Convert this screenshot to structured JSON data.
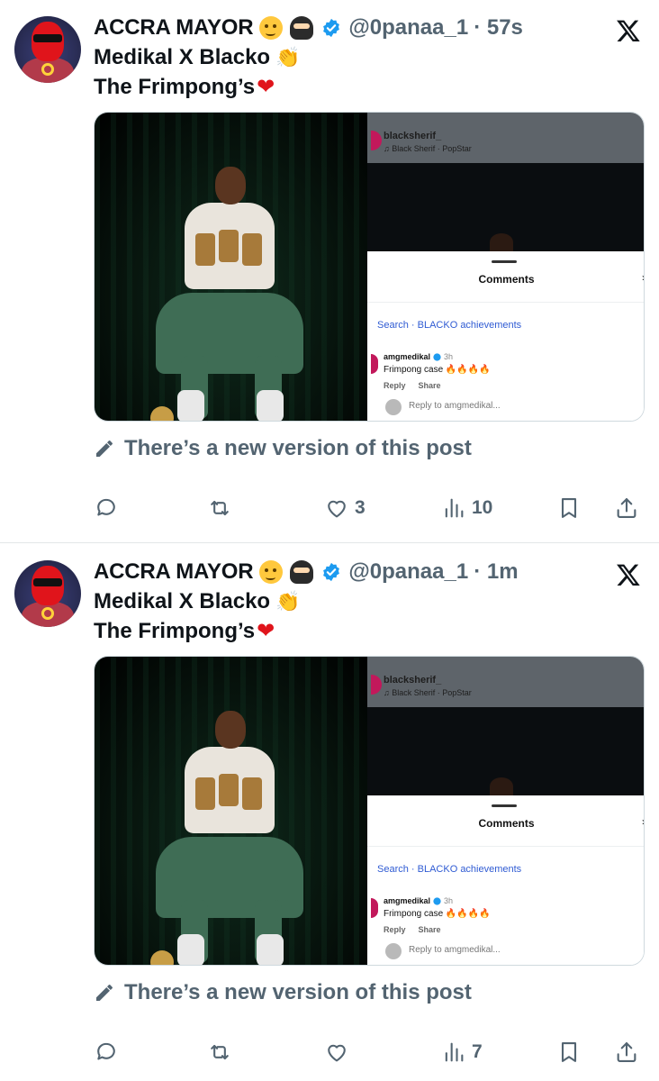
{
  "tweets": [
    {
      "author": {
        "name": "ACCRA MAYOR",
        "handle": "@0panaa_1",
        "time": "· 57s",
        "emojis": [
          "smiling-face-with-tear",
          "ninja"
        ]
      },
      "text": {
        "line1": "Medikal X Blacko",
        "line2": "The Frimpong’s"
      },
      "embed": {
        "ig_user": "blacksherif_",
        "ig_sub": "♫ Black Sherif · PopStar",
        "sheet_title": "Comments",
        "search": "Search · BLACKO achievements",
        "comment_user": "amgmedikal",
        "comment_time": "3h",
        "comment_text": "Frimpong case 🔥🔥🔥🔥",
        "reply_label": "Reply",
        "share_label": "Share",
        "reply_placeholder": "Reply to amgmedikal..."
      },
      "new_version": "There’s a new version of this post",
      "counts": {
        "replies": "",
        "reposts": "",
        "likes": "3",
        "views": "10"
      }
    },
    {
      "author": {
        "name": "ACCRA MAYOR",
        "handle": "@0panaa_1",
        "time": "· 1m",
        "emojis": [
          "smiling-face-with-tear",
          "ninja"
        ]
      },
      "text": {
        "line1": "Medikal X Blacko",
        "line2": "The Frimpong’s"
      },
      "embed": {
        "ig_user": "blacksherif_",
        "ig_sub": "♫ Black Sherif · PopStar",
        "sheet_title": "Comments",
        "search": "Search · BLACKO achievements",
        "comment_user": "amgmedikal",
        "comment_time": "3h",
        "comment_text": "Frimpong case 🔥🔥🔥🔥",
        "reply_label": "Reply",
        "share_label": "Share",
        "reply_placeholder": "Reply to amgmedikal..."
      },
      "new_version": "There’s a new version of this post",
      "counts": {
        "replies": "",
        "reposts": "",
        "likes": "",
        "views": "7"
      }
    }
  ],
  "colors": {
    "text": "#0f1419",
    "muted": "#536471",
    "verified": "#1d9bf0",
    "heart": "#e0141b",
    "link": "#2f5bd3"
  }
}
